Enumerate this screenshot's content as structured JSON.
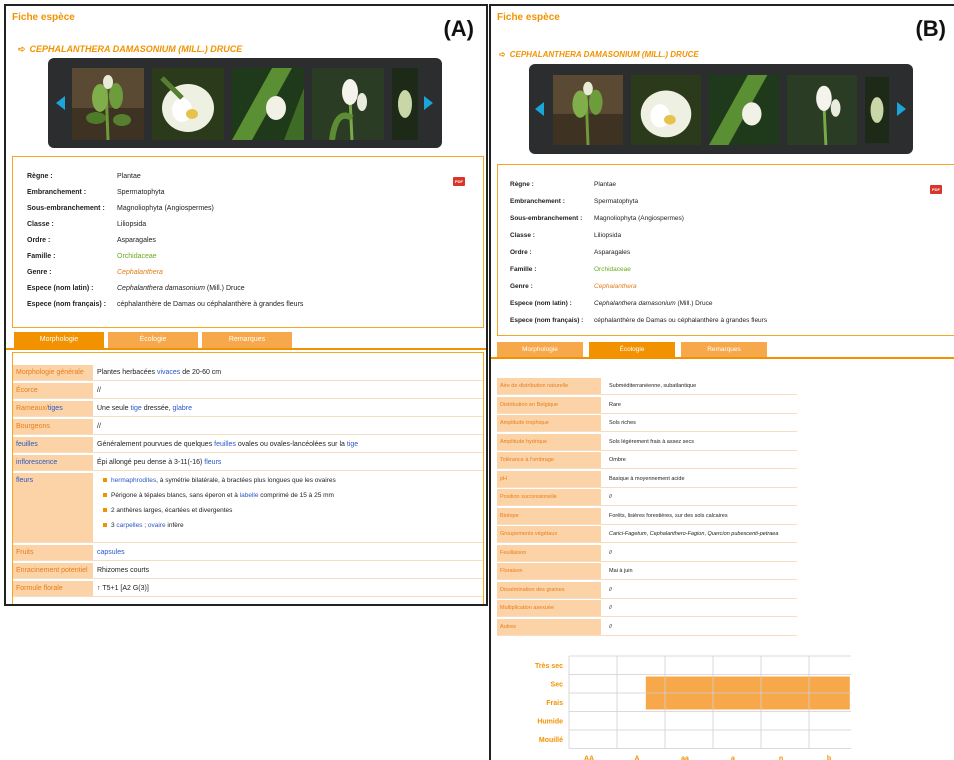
{
  "panel_a": {
    "letter": "(A)",
    "fiche_title": "Fiche espèce",
    "species_name": "CEPHALANTHERA DAMASONIUM (MILL.) DRUCE",
    "taxonomy": [
      {
        "label": "Règne :",
        "value": "Plantae"
      },
      {
        "label": "Embranchement :",
        "value": "Spermatophyta"
      },
      {
        "label": "Sous-embranchement :",
        "value": "Magnoliophyta (Angiospermes)"
      },
      {
        "label": "Classe :",
        "value": "Liliopsida"
      },
      {
        "label": "Ordre :",
        "value": "Asparagales"
      },
      {
        "label": "Famille :",
        "value": "Orchidaceae"
      },
      {
        "label": "Genre :",
        "value": "Cephalanthera"
      },
      {
        "label": "Espece (nom latin) :",
        "value_italic": "Cephalanthera damasonium",
        "value_rest": " (Mill.) Druce"
      },
      {
        "label": "Espece (nom français) :",
        "value": "céphalanthère de Damas ou céphalanthère à grandes fleurs"
      }
    ],
    "pdf_label": "PDF",
    "tabs": [
      "Morphologie",
      "Écologie",
      "Remarques"
    ],
    "morphology": {
      "generale": {
        "label": "Morphologie générale",
        "pre": "Plantes herbacées ",
        "link": "vivaces",
        "post": " de 20-60 cm"
      },
      "ecorce": {
        "label": "Écorce",
        "value": "//"
      },
      "rameaux": {
        "label_a": "Rameaux/",
        "label_b": "tiges",
        "pre": "Une seule ",
        "link1": "tige",
        "mid": " dressée, ",
        "link2": "glabre"
      },
      "bourgeons": {
        "label": "Bourgeons",
        "value": "//"
      },
      "feuilles": {
        "label": "feuilles",
        "pre": "Généralement pourvues de quelques ",
        "link1": "feuilles",
        "mid": " ovales ou ovales-lancéolées sur la ",
        "link2": "tige"
      },
      "inflorescence": {
        "label": "inflorescence",
        "pre": "Épi allongé peu dense à 3-11(-16) ",
        "link": "fleurs"
      },
      "fleurs": {
        "label": "fleurs",
        "b1_link": "hermaphrodites",
        "b1_rest": ", à symétrie bilatérale, à bractées plus longues que les ovaires",
        "b2_pre": "Périgone à tépales blancs, sans éperon et à ",
        "b2_link": "labelle",
        "b2_rest": " comprimé de 15 à 25 mm",
        "b3": "2 anthères larges, écartées et divergentes",
        "b4_pre": "3 ",
        "b4_link1": "carpelles",
        "b4_mid": " ; ",
        "b4_link2": "ovaire",
        "b4_rest": " infère"
      },
      "fruits": {
        "label": "Fruits",
        "link": "capsules"
      },
      "enracinement": {
        "label": "Enracinement potentiel",
        "value": "Rhizomes courts"
      },
      "formule": {
        "label": "Formule florale",
        "value": "↑ T5+1 [A2  G(3)]"
      }
    }
  },
  "panel_b": {
    "letter": "(B)",
    "fiche_title": "Fiche espèce",
    "species_name": "CEPHALANTHERA DAMASONIUM (MILL.) DRUCE",
    "tabs": [
      "Morphologie",
      "Écologie",
      "Remarques"
    ],
    "ecology": [
      {
        "label": "Aire de distribution naturelle",
        "value": "Subméditerranéenne, subatlantique"
      },
      {
        "label": "Distribution en Belgique",
        "value": "Rare"
      },
      {
        "label": "Amplitude trophique",
        "value": "Sols riches"
      },
      {
        "label": "Amplitude hydrique",
        "value": "Sols légèrement frais à assez secs"
      },
      {
        "label": "Tolérance à l'ombrage",
        "value": "Ombre"
      },
      {
        "label": "pH",
        "value": "Basique à moyennement acide"
      },
      {
        "label": "Position successionelle",
        "value": "//"
      },
      {
        "label": "Biotope",
        "value": "Forêts, lisières forestières, sur des sols calcaires"
      },
      {
        "label": "Groupements végétaux",
        "value_it1": "Carici-Fagetum",
        "value_mid": ", ",
        "value_it2": "Cephalanthero-Fagion",
        "value_mid2": ", ",
        "value_it3": "Quercion pubescenti-petraea"
      },
      {
        "label": "Feuillaison",
        "value": "//"
      },
      {
        "label": "Floraison",
        "value": "Mai à juin"
      },
      {
        "label": "Dissémination des graines",
        "value": "//"
      },
      {
        "label": "Multiplication asexuée",
        "value": "//"
      },
      {
        "label": "Autres",
        "value": "//"
      }
    ],
    "chart_data": {
      "type": "heatmap",
      "y_categories": [
        "Très sec",
        "Sec",
        "Frais",
        "Humide",
        "Mouillé"
      ],
      "x_categories": [
        "AA",
        "A",
        "aa",
        "a",
        "n",
        "b"
      ],
      "highlight": {
        "x_from": "A",
        "x_to": "b",
        "y_from": "Sec",
        "y_to": "Frais",
        "color": "#f7a84a"
      }
    }
  },
  "colors": {
    "accent": "#f39200",
    "link": "#2a58c6",
    "green": "#6aaa1f",
    "label_bg": "#fbd3a6",
    "gallery_bg": "#2b2d2f"
  }
}
